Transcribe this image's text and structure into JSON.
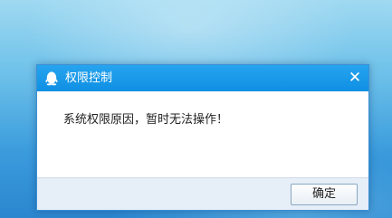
{
  "dialog": {
    "title": "权限控制",
    "title_icon": "qq-penguin-icon",
    "close_symbol": "✕",
    "message": "系统权限原因，暂时无法操作！",
    "ok_label": "确定"
  },
  "colors": {
    "titlebar": "#1a9be9",
    "footer": "#e6eef7",
    "desktop_top": "#9fd9f1",
    "desktop_bottom": "#2b86cf"
  }
}
